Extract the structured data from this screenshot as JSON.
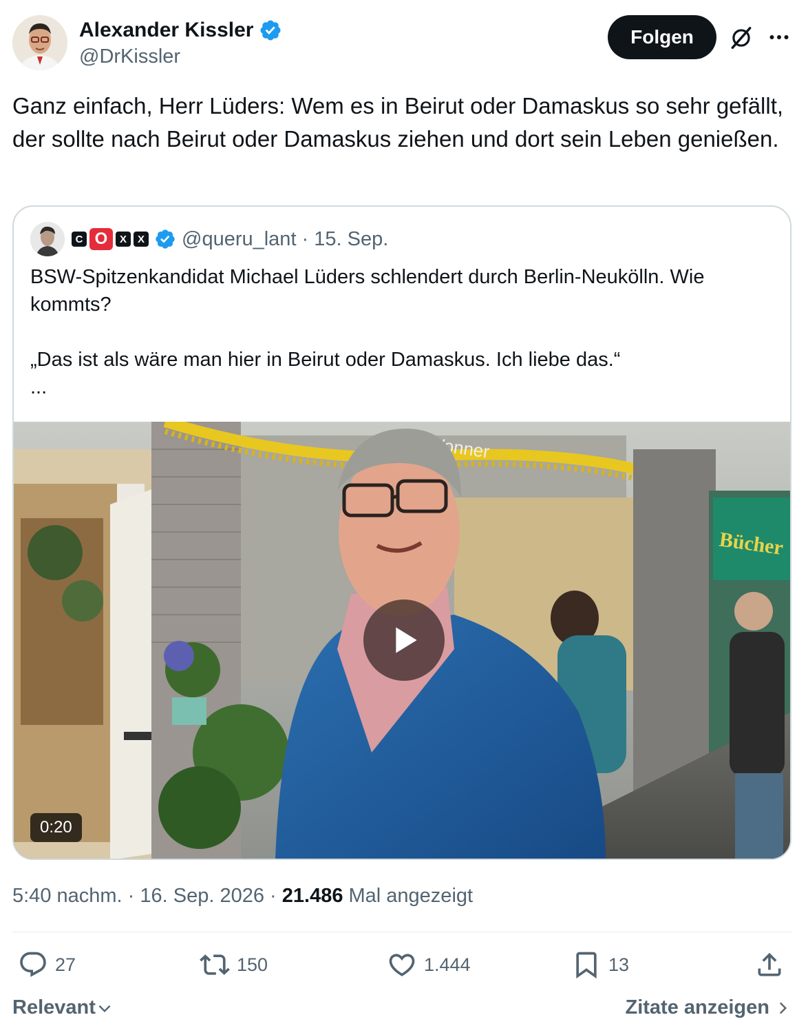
{
  "author": {
    "name": "Alexander Kissler",
    "handle": "@DrKissler",
    "verified": true
  },
  "header": {
    "follow_label": "Folgen"
  },
  "tweet": {
    "text": "Ganz einfach, Herr Lüders: Wem es in Beirut oder Damaskus so sehr gefällt, der sollte nach Beirut oder Damaskus ziehen und dort sein Leben genießen."
  },
  "quote": {
    "badges": [
      "C",
      "O",
      "X",
      "X"
    ],
    "handle_date": "@queru_lant · 15. Sep.",
    "line1": "BSW-Spitzenkandidat Michael Lüders schlendert durch Berlin-Neukölln. Wie kommts?",
    "line2": "„Das ist als wäre man hier in Beirut oder Damaskus. Ich liebe das.“",
    "ellipsis": "...",
    "video": {
      "duration": "0:20",
      "shop_sign": "Bücher",
      "window_text": "Wonner"
    }
  },
  "meta": {
    "time_date": "5:40 nachm. · 16. Sep. 2026 · ",
    "views": "21.486",
    "views_label": " Mal angezeigt"
  },
  "actions": {
    "replies": "27",
    "reposts": "150",
    "likes": "1.444",
    "bookmarks": "13"
  },
  "footer": {
    "sort_label": "Relevant",
    "quotes_label": "Zitate anzeigen"
  },
  "colors": {
    "text": "#0f1419",
    "secondary": "#536471",
    "verified": "#1d9bf0",
    "border": "#cfd9de",
    "badge_red": "#e52c3a"
  }
}
